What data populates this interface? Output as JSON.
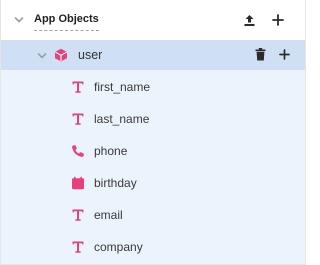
{
  "header": {
    "title": "App Objects"
  },
  "object": {
    "name": "user"
  },
  "fields": [
    {
      "name": "first_name",
      "type_icon": "text-type-icon"
    },
    {
      "name": "last_name",
      "type_icon": "text-type-icon"
    },
    {
      "name": "phone",
      "type_icon": "phone-icon"
    },
    {
      "name": "birthday",
      "type_icon": "calendar-icon"
    },
    {
      "name": "email",
      "type_icon": "text-type-icon"
    },
    {
      "name": "company",
      "type_icon": "text-type-icon"
    }
  ],
  "colors": {
    "selected_row_bg": "#cfe0f5",
    "fields_bg": "#ebf3fc",
    "accent_pink": "#e8407a",
    "icon_dark": "#2b2b2b",
    "chevron": "#9a9fa6"
  }
}
